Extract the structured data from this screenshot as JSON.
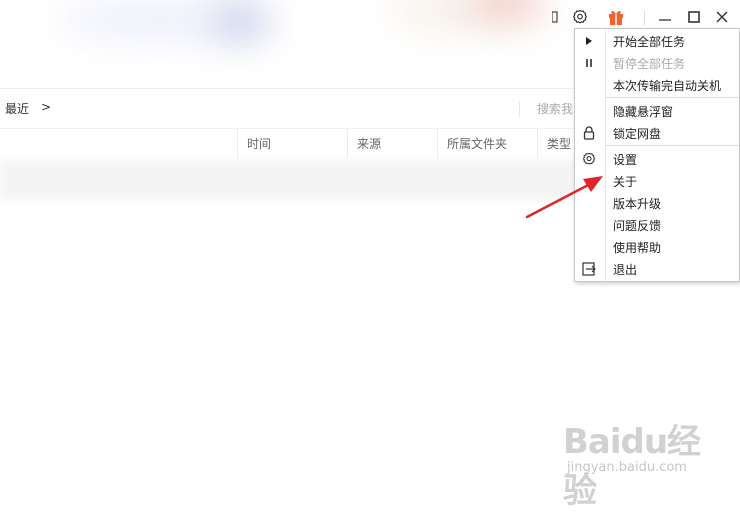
{
  "window": {
    "controls": [
      "minimize-icon",
      "maximize-icon",
      "close-icon"
    ]
  },
  "breadcrumb": {
    "current": "最近",
    "arrow": ">"
  },
  "search": {
    "placeholder": "搜索我"
  },
  "table": {
    "columns": [
      "时间",
      "来源",
      "所属文件夹",
      "类型"
    ]
  },
  "menu": {
    "items": [
      {
        "label": "开始全部任务",
        "icon": "play-icon",
        "disabled": false
      },
      {
        "label": "暂停全部任务",
        "icon": "pause-icon",
        "disabled": true
      },
      {
        "label": "本次传输完自动关机",
        "icon": "",
        "disabled": false
      },
      {
        "label": "隐藏悬浮窗",
        "icon": "",
        "disabled": false
      },
      {
        "label": "锁定网盘",
        "icon": "lock-icon",
        "disabled": false
      },
      {
        "label": "设置",
        "icon": "gear-icon",
        "disabled": false
      },
      {
        "label": "关于",
        "icon": "",
        "disabled": false
      },
      {
        "label": "版本升级",
        "icon": "",
        "disabled": false
      },
      {
        "label": "问题反馈",
        "icon": "",
        "disabled": false
      },
      {
        "label": "使用帮助",
        "icon": "",
        "disabled": false
      },
      {
        "label": "退出",
        "icon": "exit-icon",
        "disabled": false
      }
    ]
  },
  "watermark": {
    "logo": "Baidu经验",
    "url": "jingyan.baidu.com"
  },
  "colors": {
    "arrow": "#e0262b",
    "gift": "#f0632e"
  }
}
